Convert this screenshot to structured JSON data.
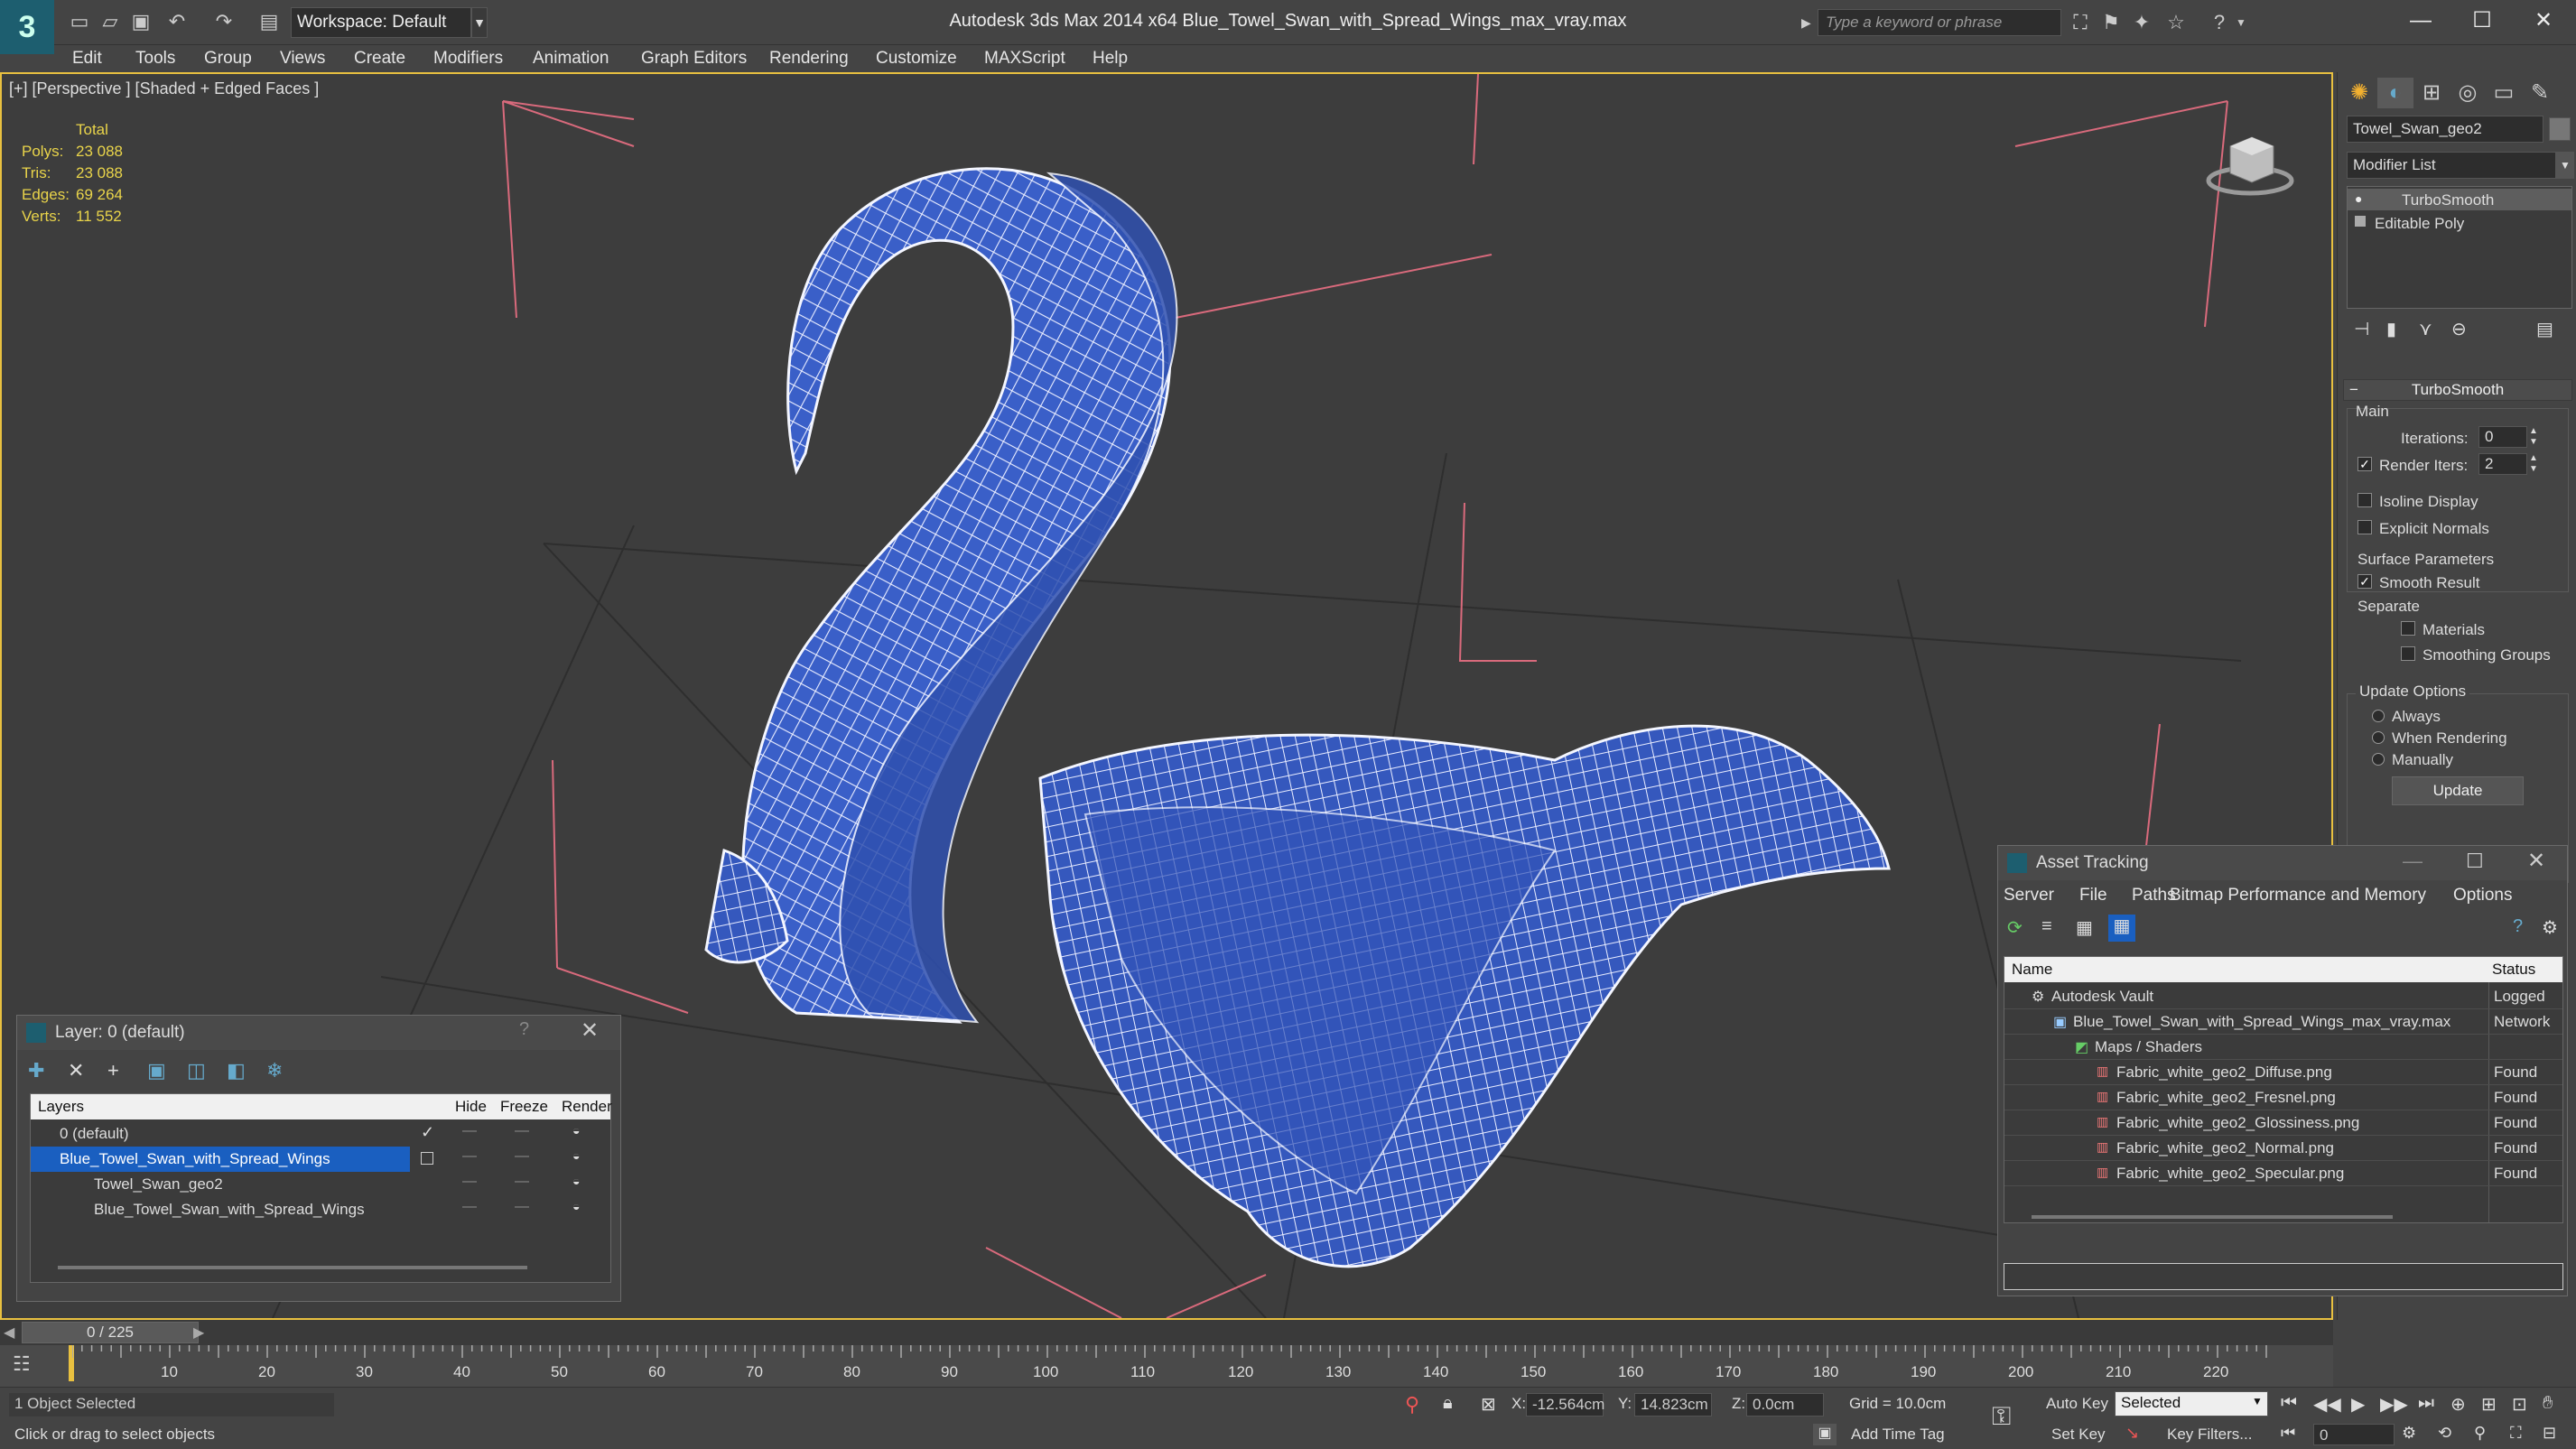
{
  "app": {
    "window_title": "Autodesk 3ds Max  2014 x64      Blue_Towel_Swan_with_Spread_Wings_max_vray.max",
    "workspace": "Workspace: Default",
    "search_placeholder": "Type a keyword or phrase"
  },
  "menu": [
    "Edit",
    "Tools",
    "Group",
    "Views",
    "Create",
    "Modifiers",
    "Animation",
    "Graph Editors",
    "Rendering",
    "Customize",
    "MAXScript",
    "Help"
  ],
  "viewport": {
    "label": "[+] [Perspective ] [Shaded + Edged Faces ]",
    "stats_header": "Total",
    "stats": [
      {
        "k": "Polys:",
        "v": "23 088"
      },
      {
        "k": "Tris:",
        "v": "23 088"
      },
      {
        "k": "Edges:",
        "v": "69 264"
      },
      {
        "k": "Verts:",
        "v": "11 552"
      }
    ]
  },
  "command_panel": {
    "object_name": "Towel_Swan_geo2",
    "modifier_list": "Modifier List",
    "stack": [
      "TurboSmooth",
      "Editable Poly"
    ],
    "rollout_title": "TurboSmooth",
    "main_label": "Main",
    "iterations_label": "Iterations:",
    "iterations_value": "0",
    "render_iters_label": "Render Iters:",
    "render_iters_value": "2",
    "isoline_label": "Isoline Display",
    "explicit_normals_label": "Explicit Normals",
    "surface_params_label": "Surface Parameters",
    "smooth_result_label": "Smooth Result",
    "separate_label": "Separate",
    "materials_label": "Materials",
    "smoothing_groups_label": "Smoothing Groups",
    "update_options_label": "Update Options",
    "always_label": "Always",
    "when_rendering_label": "When Rendering",
    "manually_label": "Manually",
    "update_button": "Update"
  },
  "layer_window": {
    "title": "Layer: 0 (default)",
    "help": "?",
    "columns": [
      "Layers",
      "Hide",
      "Freeze",
      "Render"
    ],
    "rows": [
      {
        "name": "0 (default)",
        "indent": 0
      },
      {
        "name": "Blue_Towel_Swan_with_Spread_Wings",
        "indent": 0
      },
      {
        "name": "Towel_Swan_geo2",
        "indent": 1
      },
      {
        "name": "Blue_Towel_Swan_with_Spread_Wings",
        "indent": 1
      }
    ]
  },
  "asset_window": {
    "title": "Asset Tracking",
    "menu": [
      "Server",
      "File",
      "Paths",
      "Bitmap Performance and Memory",
      "Options"
    ],
    "columns": [
      "Name",
      "Status"
    ],
    "rows": [
      {
        "name": "Autodesk Vault",
        "status": "Logged",
        "indent": 0
      },
      {
        "name": "Blue_Towel_Swan_with_Spread_Wings_max_vray.max",
        "status": "Network",
        "indent": 1
      },
      {
        "name": "Maps / Shaders",
        "status": "",
        "indent": 2
      },
      {
        "name": "Fabric_white_geo2_Diffuse.png",
        "status": "Found",
        "indent": 3
      },
      {
        "name": "Fabric_white_geo2_Fresnel.png",
        "status": "Found",
        "indent": 3
      },
      {
        "name": "Fabric_white_geo2_Glossiness.png",
        "status": "Found",
        "indent": 3
      },
      {
        "name": "Fabric_white_geo2_Normal.png",
        "status": "Found",
        "indent": 3
      },
      {
        "name": "Fabric_white_geo2_Specular.png",
        "status": "Found",
        "indent": 3
      }
    ]
  },
  "timeline": {
    "frame_counter": "0 / 225",
    "ticks": [
      "10",
      "20",
      "30",
      "40",
      "50",
      "60",
      "70",
      "80",
      "90",
      "100",
      "110",
      "120",
      "130",
      "140",
      "150",
      "160",
      "170",
      "180",
      "190",
      "200",
      "210",
      "220"
    ]
  },
  "status": {
    "selection": "1 Object Selected",
    "prompt": "Click or drag to select objects",
    "x_label": "X:",
    "x_value": "-12.564cm",
    "y_label": "Y:",
    "y_value": "14.823cm",
    "z_label": "Z:",
    "z_value": "0.0cm",
    "grid": "Grid = 10.0cm",
    "add_time_tag": "Add Time Tag",
    "auto_key": "Auto Key",
    "set_key": "Set Key",
    "selected": "Selected",
    "key_filters": "Key Filters...",
    "frame_value": "0"
  },
  "colors": {
    "swan_blue": "#3a5fc8",
    "wire": "#e8ecff",
    "viewport_border": "#e8c040",
    "stats_yellow": "#e9d44a",
    "selection": "#1a5fc0"
  }
}
